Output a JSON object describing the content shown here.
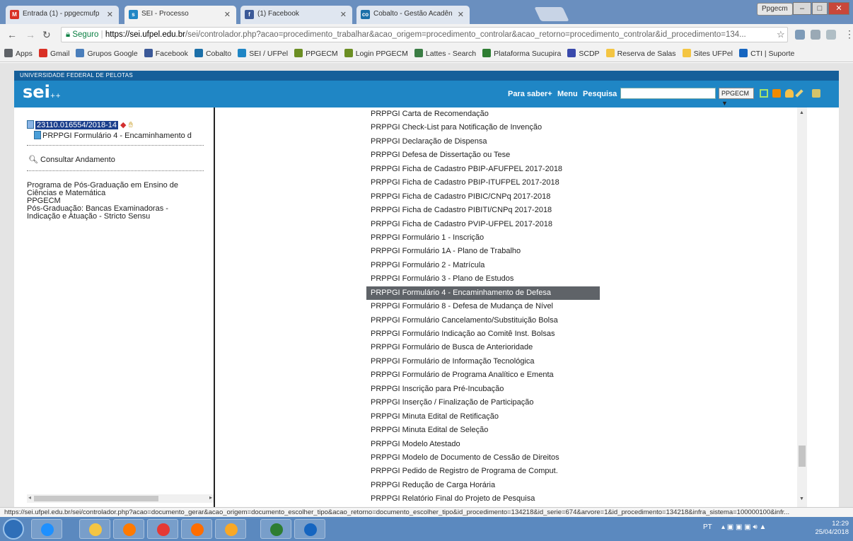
{
  "browser": {
    "tabs": [
      {
        "label": "Entrada (1) - ppgecmufp",
        "icon": "gmail-icon",
        "color": "#d93025"
      },
      {
        "label": "SEI - Processo",
        "icon": "sei-icon",
        "color": "#1f86c5"
      },
      {
        "label": "(1) Facebook",
        "icon": "facebook-icon",
        "color": "#3b5998"
      },
      {
        "label": "Cobalto - Gestão Acadên",
        "icon": "cobalto-icon",
        "color": "#1b6fa8"
      }
    ],
    "profile": "Ppgecm",
    "window_buttons": {
      "minimize": "–",
      "maximize": "□",
      "close": "✕"
    },
    "secure_label": "Seguro",
    "url_host": "https://sei.ufpel.edu.br",
    "url_path": "/sei/controlador.php?acao=procedimento_trabalhar&acao_origem=procedimento_controlar&acao_retorno=procedimento_controlar&id_procedimento=134...",
    "bookmarks": [
      {
        "label": "Apps",
        "color": "#5f6368"
      },
      {
        "label": "Gmail",
        "color": "#d93025"
      },
      {
        "label": "Grupos Google",
        "color": "#4a7ebb"
      },
      {
        "label": "Facebook",
        "color": "#3b5998"
      },
      {
        "label": "Cobalto",
        "color": "#1b6fa8"
      },
      {
        "label": "SEI / UFPel",
        "color": "#1f86c5"
      },
      {
        "label": "PPGECM",
        "color": "#6b8e23"
      },
      {
        "label": "Login PPGECM",
        "color": "#6b8e23"
      },
      {
        "label": "Lattes - Search",
        "color": "#3a7d44"
      },
      {
        "label": "Plataforma Sucupira",
        "color": "#2e7d32"
      },
      {
        "label": "SCDP",
        "color": "#3949ab"
      },
      {
        "label": "Reserva de Salas",
        "color": "#f4c542"
      },
      {
        "label": "Sites UFPel",
        "color": "#f4c542"
      },
      {
        "label": "CTI | Suporte",
        "color": "#1565c0"
      }
    ],
    "status_url": "https://sei.ufpel.edu.br/sei/controlador.php?acao=documento_gerar&acao_origem=documento_escolher_tipo&acao_retorno=documento_escolher_tipo&id_procedimento=134218&id_serie=674&arvore=1&id_procedimento=134218&infra_sistema=100000100&infr..."
  },
  "sei": {
    "institution": "UNIVERSIDADE FEDERAL DE PELOTAS",
    "logo": "sei",
    "logo_suffix": "++",
    "header_links": {
      "para_saber": "Para saber+",
      "menu": "Menu",
      "pesquisa": "Pesquisa"
    },
    "unit": "PPGECM ▼",
    "accent_color": "#1f86c5"
  },
  "tree": {
    "process_number": "23110.016554/2018-14",
    "document": "PRPPGI Formulário 4 - Encaminhamento d",
    "consultar": "Consultar Andamento",
    "info_lines": [
      "Programa de Pós-Graduação em Ensino de",
      "Ciências e Matemática",
      "PPGECM",
      "Pós-Graduação: Bancas Examinadoras -",
      "Indicação e Atuação - Stricto Sensu"
    ]
  },
  "document_types": [
    "PRPPGI Carta de Recomendação",
    "PRPPGI Check-List para Notificação de Invenção",
    "PRPPGI Declaração de Dispensa",
    "PRPPGI Defesa de Dissertação ou Tese",
    "PRPPGI Ficha de Cadastro PBIP-AFUFPEL 2017-2018",
    "PRPPGI Ficha de Cadastro PBIP-ITUFPEL 2017-2018",
    "PRPPGI Ficha de Cadastro PIBIC/CNPq 2017-2018",
    "PRPPGI Ficha de Cadastro PIBITI/CNPq 2017-2018",
    "PRPPGI Ficha de Cadastro PVIP-UFPEL 2017-2018",
    "PRPPGI Formulário 1 - Inscrição",
    "PRPPGI Formulário 1A - Plano de Trabalho",
    "PRPPGI Formulário 2 - Matrícula",
    "PRPPGI Formulário 3 - Plano de Estudos",
    "PRPPGI Formulário 4 - Encaminhamento de Defesa",
    "PRPPGI Formulário 8 - Defesa de Mudança de Nível",
    "PRPPGI Formulário Cancelamento/Substituição Bolsa",
    "PRPPGI Formulário Indicação ao Comitê Inst. Bolsas",
    "PRPPGI Formulário de Busca de Anterioridade",
    "PRPPGI Formulário de Informação Tecnológica",
    "PRPPGI Formulário de Programa Analítico e Ementa",
    "PRPPGI Inscrição para Pré-Incubação",
    "PRPPGI Inserção / Finalização de Participação",
    "PRPPGI Minuta Edital de Retificação",
    "PRPPGI Minuta Edital de Seleção",
    "PRPPGI Modelo Atestado",
    "PRPPGI Modelo de Documento de Cessão de Direitos",
    "PRPPGI Pedido de Registro de Programa de Comput.",
    "PRPPGI Redução de Carga Horária",
    "PRPPGI Relatório Final do Projeto de Pesquisa"
  ],
  "selected_index": 13,
  "taskbar": {
    "apps": [
      {
        "name": "ie-icon",
        "color": "#1e90ff"
      },
      {
        "name": "explorer-icon",
        "color": "#f4c542"
      },
      {
        "name": "media-player-icon",
        "color": "#ff7a00"
      },
      {
        "name": "chrome-icon",
        "color": "#e53935"
      },
      {
        "name": "firefox-icon",
        "color": "#ff6d00"
      },
      {
        "name": "paint-icon",
        "color": "#f9a825"
      },
      {
        "name": "excel-icon",
        "color": "#2e7d32"
      },
      {
        "name": "word-icon",
        "color": "#1565c0"
      }
    ],
    "language": "PT",
    "time": "12:29",
    "date": "25/04/2018"
  }
}
